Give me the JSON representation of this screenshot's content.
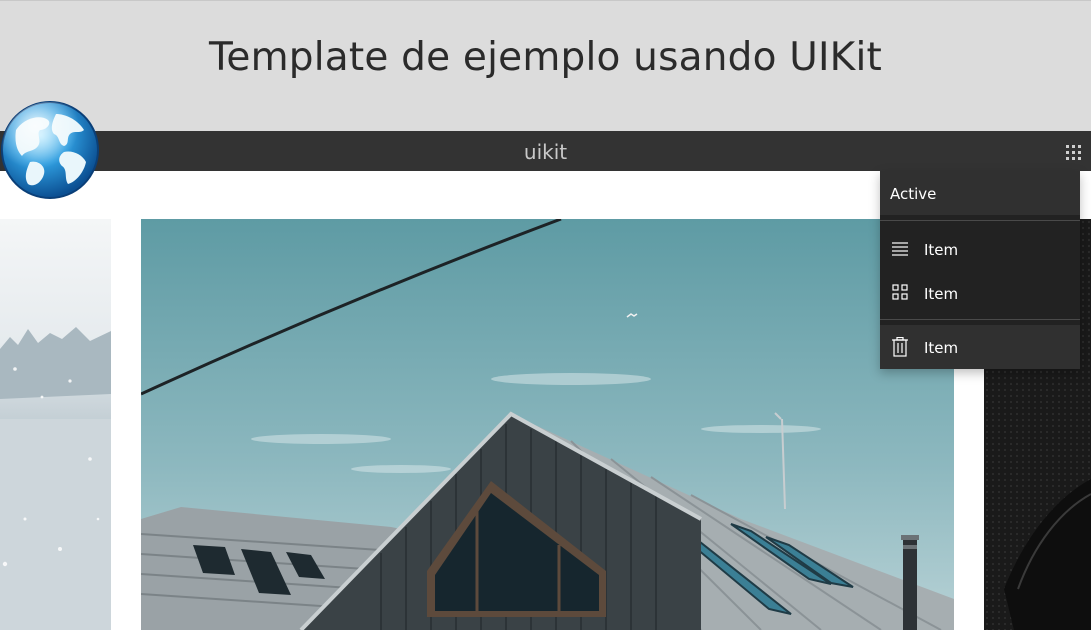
{
  "header": {
    "title": "Template de ejemplo usando UIKit"
  },
  "navbar": {
    "brand": "uikit",
    "menu_icon": "grid-icon"
  },
  "logo": {
    "icon": "globe-icon"
  },
  "dropdown": {
    "active_label": "Active",
    "items": [
      {
        "label": "Item",
        "icon": "list-icon"
      },
      {
        "label": "Item",
        "icon": "thumbnails-icon"
      },
      {
        "label": "Item",
        "icon": "trash-icon"
      }
    ]
  },
  "slideshow": {
    "slides": [
      {
        "subject": "snowy forest"
      },
      {
        "subject": "dark wooden house with gabled roof"
      },
      {
        "subject": "dark textured surface"
      }
    ]
  },
  "colors": {
    "header_bg": "#dcdcdc",
    "navbar_bg": "#333333",
    "dropdown_bg": "#222222",
    "title_text": "#2b2b2b"
  }
}
